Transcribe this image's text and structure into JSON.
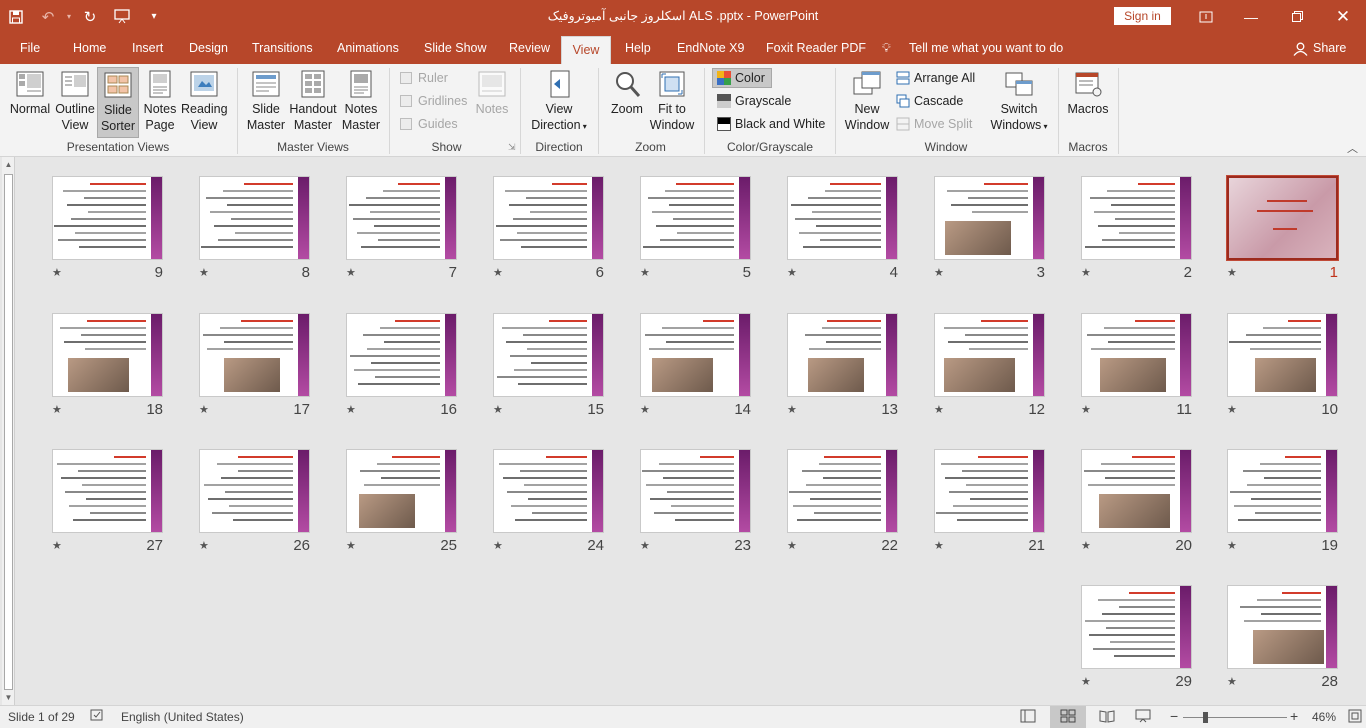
{
  "window": {
    "title": "اسکلروز جانبی آمیوتروفیک ALS .pptx  -  PowerPoint",
    "signin": "Sign in"
  },
  "tabs": [
    "File",
    "Home",
    "Insert",
    "Design",
    "Transitions",
    "Animations",
    "Slide Show",
    "Review",
    "View",
    "Help",
    "EndNote X9",
    "Foxit Reader PDF",
    "Tell me what you want to do",
    "Share"
  ],
  "active_tab": "View",
  "ribbon": {
    "presentation_views": {
      "label": "Presentation Views",
      "normal": "Normal",
      "outline": [
        "Outline",
        "View"
      ],
      "slide_sorter": [
        "Slide",
        "Sorter"
      ],
      "notes_page": [
        "Notes",
        "Page"
      ],
      "reading_view": [
        "Reading",
        "View"
      ]
    },
    "master_views": {
      "label": "Master Views",
      "slide_master": [
        "Slide",
        "Master"
      ],
      "handout_master": [
        "Handout",
        "Master"
      ],
      "notes_master": [
        "Notes",
        "Master"
      ]
    },
    "show": {
      "label": "Show",
      "ruler": "Ruler",
      "gridlines": "Gridlines",
      "guides": "Guides",
      "notes": "Notes"
    },
    "direction": {
      "label": "Direction",
      "btn": [
        "View",
        "Direction"
      ]
    },
    "zoom": {
      "label": "Zoom",
      "zoom": "Zoom",
      "fit": [
        "Fit to",
        "Window"
      ]
    },
    "color": {
      "label": "Color/Grayscale",
      "color": "Color",
      "grayscale": "Grayscale",
      "bw": "Black and White"
    },
    "window": {
      "label": "Window",
      "new": [
        "New",
        "Window"
      ],
      "arrange": "Arrange All",
      "cascade": "Cascade",
      "move_split": "Move Split",
      "switch": [
        "Switch",
        "Windows"
      ]
    },
    "macros": {
      "label": "Macros",
      "btn": "Macros"
    }
  },
  "slides": [
    {
      "n": "1",
      "row": 0,
      "col": 0
    },
    {
      "n": "2",
      "row": 0,
      "col": 1
    },
    {
      "n": "3",
      "row": 0,
      "col": 2
    },
    {
      "n": "4",
      "row": 0,
      "col": 3
    },
    {
      "n": "5",
      "row": 0,
      "col": 4
    },
    {
      "n": "6",
      "row": 0,
      "col": 5
    },
    {
      "n": "7",
      "row": 0,
      "col": 6
    },
    {
      "n": "8",
      "row": 0,
      "col": 7
    },
    {
      "n": "9",
      "row": 0,
      "col": 8
    },
    {
      "n": "10",
      "row": 1,
      "col": 0
    },
    {
      "n": "11",
      "row": 1,
      "col": 1
    },
    {
      "n": "12",
      "row": 1,
      "col": 2
    },
    {
      "n": "13",
      "row": 1,
      "col": 3
    },
    {
      "n": "14",
      "row": 1,
      "col": 4
    },
    {
      "n": "15",
      "row": 1,
      "col": 5
    },
    {
      "n": "16",
      "row": 1,
      "col": 6
    },
    {
      "n": "17",
      "row": 1,
      "col": 7
    },
    {
      "n": "18",
      "row": 1,
      "col": 8
    },
    {
      "n": "19",
      "row": 2,
      "col": 0
    },
    {
      "n": "20",
      "row": 2,
      "col": 1
    },
    {
      "n": "21",
      "row": 2,
      "col": 2
    },
    {
      "n": "22",
      "row": 2,
      "col": 3
    },
    {
      "n": "23",
      "row": 2,
      "col": 4
    },
    {
      "n": "24",
      "row": 2,
      "col": 5
    },
    {
      "n": "25",
      "row": 2,
      "col": 6
    },
    {
      "n": "26",
      "row": 2,
      "col": 7
    },
    {
      "n": "27",
      "row": 2,
      "col": 8
    },
    {
      "n": "28",
      "row": 3,
      "col": 0
    },
    {
      "n": "29",
      "row": 3,
      "col": 1
    }
  ],
  "selected_slide": "1",
  "status": {
    "slide_info": "Slide 1 of 29",
    "language": "English (United States)",
    "zoom": "46%"
  }
}
